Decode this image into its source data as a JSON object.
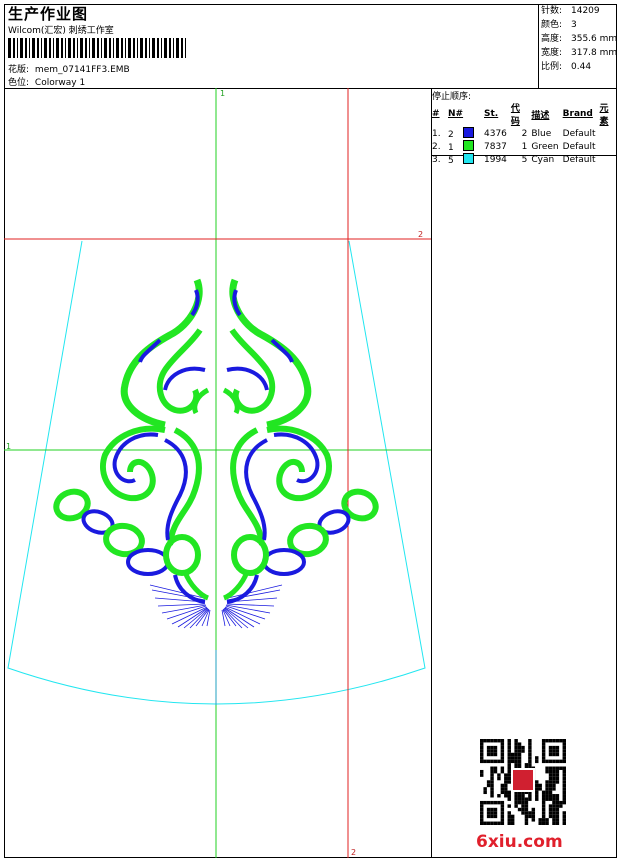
{
  "header": {
    "title": "生产作业图",
    "company": "Wilcom(汇宏) 刺绣工作室",
    "design_file_label": "花版:",
    "design_file": "mem_07141FF3.EMB",
    "colorway_label": "色位:",
    "colorway": "Colorway 1"
  },
  "specs": [
    {
      "label": "针数:",
      "value": "14209"
    },
    {
      "label": "颜色:",
      "value": "3"
    },
    {
      "label": "高度:",
      "value": "355.6 mm"
    },
    {
      "label": "宽度:",
      "value": "317.8 mm"
    },
    {
      "label": "比例:",
      "value": "0.44"
    }
  ],
  "stop_sequence": {
    "title": "停止顺序:",
    "columns": [
      "#",
      "N#",
      "St.",
      "代码",
      "描述",
      "Brand",
      "元素"
    ],
    "rows": [
      {
        "idx": "1.",
        "n": "2",
        "color": "#1a1adf",
        "st": "4376",
        "code": "2",
        "desc": "Blue",
        "brand": "Default"
      },
      {
        "idx": "2.",
        "n": "1",
        "color": "#22e622",
        "st": "7837",
        "code": "1",
        "desc": "Green",
        "brand": "Default"
      },
      {
        "idx": "3.",
        "n": "5",
        "color": "#22e6f0",
        "st": "1994",
        "code": "5",
        "desc": "Cyan",
        "brand": "Default"
      }
    ]
  },
  "guides": {
    "v_green": "1",
    "h_red": "2",
    "h_green": "1",
    "v_red": "2"
  },
  "colors": {
    "blue": "#1a1adf",
    "green": "#22e622",
    "cyan": "#22e6f0",
    "red_guide": "#e02020",
    "green_guide": "#22d022"
  },
  "watermark": {
    "text": "6xiu.com"
  }
}
